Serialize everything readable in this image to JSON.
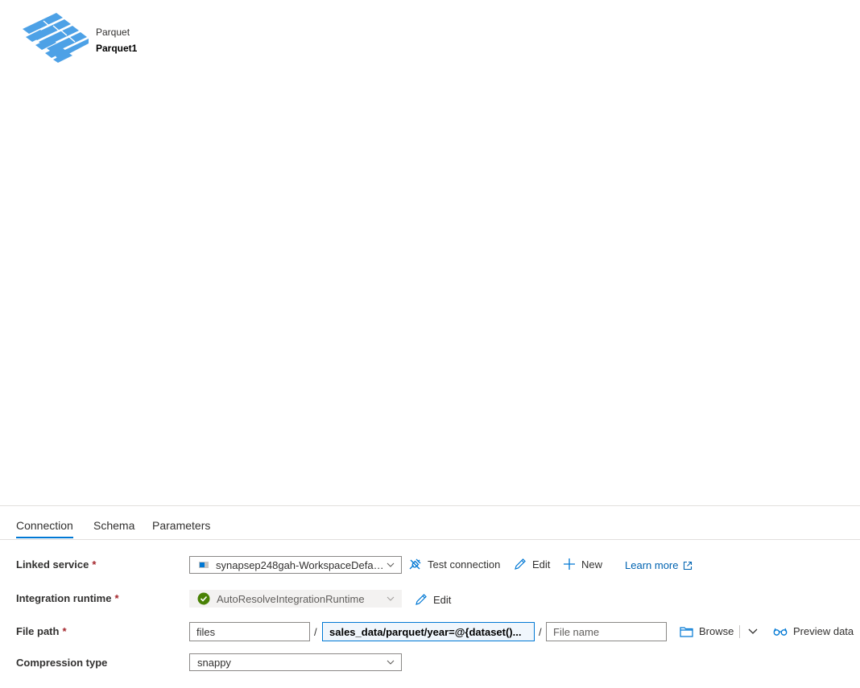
{
  "header": {
    "dataset_type": "Parquet",
    "dataset_name": "Parquet1",
    "icon": "parquet-icon",
    "icon_color": "#4da1e6"
  },
  "tabs": [
    {
      "label": "Connection",
      "active": true
    },
    {
      "label": "Schema",
      "active": false
    },
    {
      "label": "Parameters",
      "active": false
    }
  ],
  "linked_service": {
    "label": "Linked service",
    "value": "synapsep248gah-WorkspaceDefaultStorage",
    "test_connection": "Test connection",
    "edit": "Edit",
    "new": "New",
    "learn_more": "Learn more"
  },
  "integration_runtime": {
    "label": "Integration runtime",
    "value": "AutoResolveIntegrationRuntime",
    "edit": "Edit"
  },
  "file_path": {
    "label": "File path",
    "container": "files",
    "directory": "sales_data/parquet/year=@{dataset()...",
    "file_name_placeholder": "File name",
    "separator": "/",
    "browse": "Browse",
    "preview": "Preview data"
  },
  "compression": {
    "label": "Compression type",
    "value": "snappy"
  },
  "required_mark": "*",
  "colors": {
    "accent": "#0078d4",
    "success": "#498205",
    "required": "#a4262c",
    "link": "#0063b1"
  }
}
